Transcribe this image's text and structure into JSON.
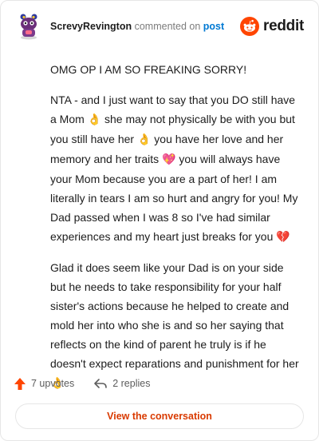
{
  "header": {
    "username": "ScrevyRevington",
    "action_text": "commented on",
    "post_link_text": "post",
    "brand_wordmark": "reddit"
  },
  "comment": {
    "paragraph1": "OMG OP I AM SO FREAKING SORRY!",
    "paragraph2": {
      "segments": [
        "NTA - and I just want to say that you DO still have a Mom",
        "she may not physically be with you but you still have her",
        "you have her love and her memory and her traits",
        "you will always have your Mom because you are a part of her! I am literally in tears I am so hurt and angry for you! My Dad passed when I was 8 so I've had similar experiences and my heart just breaks for you"
      ],
      "emojis": [
        "👌",
        "👌",
        "💖",
        "💔"
      ]
    },
    "paragraph3": {
      "text": "Glad it does seem like your Dad is on your side but he needs to take responsibility for your half sister's actions because he helped to create and mold her into who she is and so her saying that reflects on the kind of parent he truly is if he doesn't expect reparations and punishment for her",
      "emoji": "👌"
    }
  },
  "footer": {
    "upvotes": "7 upvotes",
    "replies": "2 replies"
  },
  "cta": {
    "label": "View the conversation"
  },
  "colors": {
    "accent_orange": "#ff4500",
    "link_blue": "#0079d3",
    "cta_text": "#d93a00"
  },
  "icons": {
    "avatar": "snoo-avatar",
    "brand": "reddit-snoo-icon",
    "upvote": "upvote-arrow-icon",
    "reply": "reply-arrow-icon"
  }
}
